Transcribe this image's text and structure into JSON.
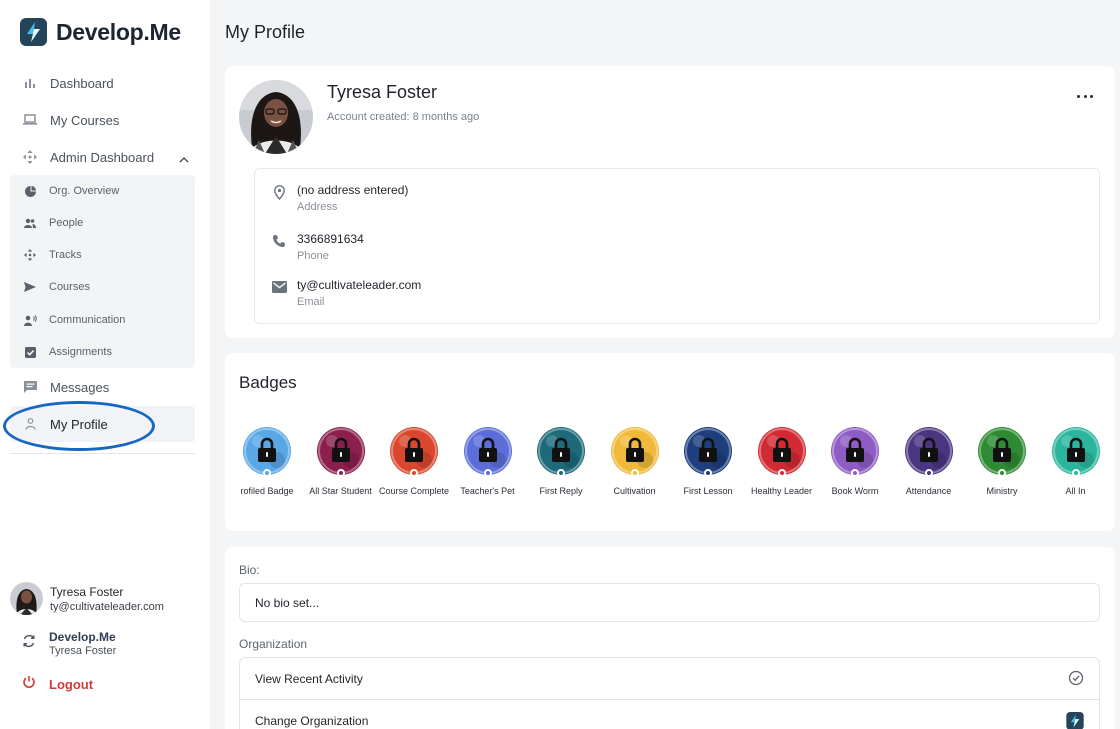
{
  "brand": {
    "name": "Develop.Me",
    "color": "#244559"
  },
  "sidebar": {
    "items": [
      {
        "label": "Dashboard",
        "icon": "bar-chart-icon"
      },
      {
        "label": "My Courses",
        "icon": "laptop-icon"
      },
      {
        "label": "Admin Dashboard",
        "icon": "move-arrows-icon"
      },
      {
        "label": "Messages",
        "icon": "chat-icon"
      },
      {
        "label": "My Profile",
        "icon": "person-icon"
      }
    ],
    "admin_sub": [
      {
        "label": "Org. Overview",
        "icon": "pie-chart-icon"
      },
      {
        "label": "People",
        "icon": "people-icon"
      },
      {
        "label": "Tracks",
        "icon": "move-arrows-icon"
      },
      {
        "label": "Courses",
        "icon": "send-icon"
      },
      {
        "label": "Communication",
        "icon": "speaker-person-icon"
      },
      {
        "label": "Assignments",
        "icon": "checkbox-icon"
      }
    ],
    "user": {
      "name": "Tyresa Foster",
      "email": "ty@cultivateleader.com"
    },
    "org": {
      "name": "Develop.Me",
      "sub": "Tyresa Foster"
    },
    "logout_label": "Logout",
    "highlight_color": "#1667c4",
    "logout_color": "#d23b3b"
  },
  "page": {
    "title": "My Profile"
  },
  "profile": {
    "name": "Tyresa Foster",
    "created": "Account created: 8 months ago",
    "address": {
      "value": "(no address entered)",
      "caption": "Address"
    },
    "phone": {
      "value": "3366891634",
      "caption": "Phone"
    },
    "email": {
      "value": "ty@cultivateleader.com",
      "caption": "Email"
    }
  },
  "badges": {
    "title": "Badges",
    "items": [
      {
        "label": "rofiled Badge",
        "color": "#5aa7e6"
      },
      {
        "label": "All Star Student",
        "color": "#8b1f4e"
      },
      {
        "label": "Course Complete",
        "color": "#d9482e"
      },
      {
        "label": "Teacher's Pet",
        "color": "#5b6ed8"
      },
      {
        "label": "First Reply",
        "color": "#1c6a7a"
      },
      {
        "label": "Cultivation",
        "color": "#f0b93a"
      },
      {
        "label": "First Lesson",
        "color": "#1e3e7d"
      },
      {
        "label": "Healthy Leader",
        "color": "#d22a32"
      },
      {
        "label": "Book Worm",
        "color": "#8e5cc4"
      },
      {
        "label": "Attendance",
        "color": "#4a3580"
      },
      {
        "label": "Ministry",
        "color": "#2f8a34"
      },
      {
        "label": "All In",
        "color": "#2ab59c"
      }
    ]
  },
  "bio": {
    "label": "Bio:",
    "value": "No bio set..."
  },
  "organization": {
    "label": "Organization",
    "rows": [
      {
        "label": "View Recent Activity"
      },
      {
        "label": "Change Organization"
      }
    ]
  }
}
